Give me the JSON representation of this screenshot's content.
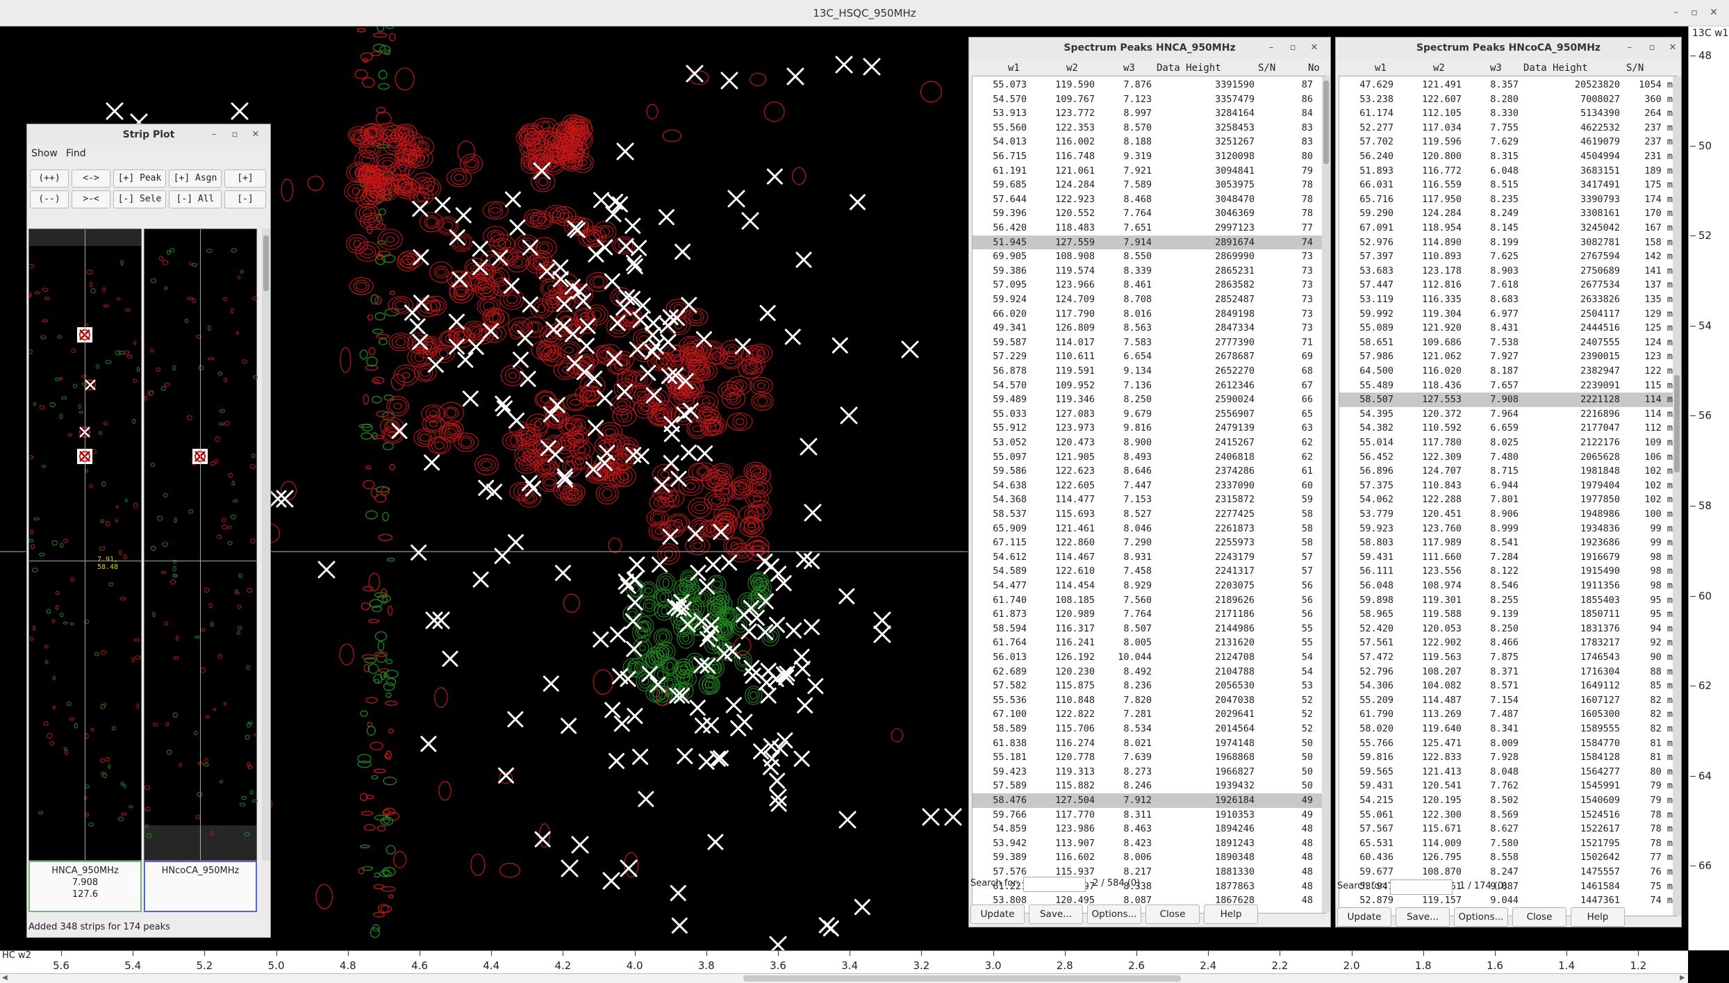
{
  "app": {
    "window_title": "13C_HSQC_950MHz",
    "controls": [
      "–",
      "▫",
      "✕"
    ]
  },
  "spectrum": {
    "xaxis_title": "HC w2",
    "yaxis_title": "13C w1",
    "xticks": [
      "5.6",
      "5.4",
      "5.2",
      "5.0",
      "4.8",
      "4.6",
      "4.4",
      "4.2",
      "4.0",
      "3.8",
      "3.6",
      "3.4",
      "3.2",
      "3.0",
      "2.8",
      "2.6",
      "2.4",
      "2.2",
      "2.0",
      "1.8",
      "1.6",
      "1.4",
      "1.2"
    ],
    "yticks": [
      "48",
      "50",
      "52",
      "54",
      "56",
      "58",
      "60",
      "62",
      "64",
      "66"
    ]
  },
  "strip_plot": {
    "title": "Strip Plot",
    "menus": [
      "Show",
      "Find"
    ],
    "row1": [
      "(++)",
      "<->",
      "[+] Peak",
      "[+] Asgn",
      "[+] Matc"
    ],
    "row2": [
      "(--)",
      ">-<",
      "[-] Sele",
      "[-] All",
      "[-] Matc"
    ],
    "cursor_label": "7.91, 58.48",
    "strips": [
      {
        "name": "HNCA_950MHz",
        "w3": "7.908",
        "w2": "127.6"
      },
      {
        "name": "HNcoCA_950MHz",
        "w3": "",
        "w2": ""
      }
    ],
    "status": "Added 348 strips for 174 peaks"
  },
  "peaks_hnca": {
    "title": "Spectrum Peaks HNCA_950MHz",
    "columns": [
      "w1",
      "w2",
      "w3",
      "Data Height",
      "S/N",
      "No"
    ],
    "rows": [
      [
        "55.073",
        "119.590",
        "7.876",
        "3391590",
        "87"
      ],
      [
        "54.570",
        "109.767",
        "7.123",
        "3357479",
        "86"
      ],
      [
        "53.913",
        "123.772",
        "8.997",
        "3284164",
        "84"
      ],
      [
        "55.560",
        "122.353",
        "8.570",
        "3258453",
        "83"
      ],
      [
        "54.013",
        "116.002",
        "8.188",
        "3251267",
        "83"
      ],
      [
        "56.715",
        "116.748",
        "9.319",
        "3120098",
        "80"
      ],
      [
        "61.191",
        "121.061",
        "7.921",
        "3094841",
        "79"
      ],
      [
        "59.685",
        "124.284",
        "7.589",
        "3053975",
        "78"
      ],
      [
        "57.644",
        "122.923",
        "8.468",
        "3048470",
        "78"
      ],
      [
        "59.396",
        "120.552",
        "7.764",
        "3046369",
        "78"
      ],
      [
        "56.420",
        "118.483",
        "7.651",
        "2997123",
        "77"
      ],
      [
        "51.945",
        "127.559",
        "7.914",
        "2891674",
        "74"
      ],
      [
        "69.905",
        "108.908",
        "8.550",
        "2869990",
        "73"
      ],
      [
        "59.386",
        "119.574",
        "8.339",
        "2865231",
        "73"
      ],
      [
        "57.095",
        "123.966",
        "8.461",
        "2863582",
        "73"
      ],
      [
        "59.924",
        "124.709",
        "8.708",
        "2852487",
        "73"
      ],
      [
        "66.020",
        "117.790",
        "8.016",
        "2849198",
        "73"
      ],
      [
        "49.341",
        "126.809",
        "8.563",
        "2847334",
        "73"
      ],
      [
        "59.587",
        "114.017",
        "7.583",
        "2777390",
        "71"
      ],
      [
        "57.229",
        "110.611",
        "6.654",
        "2678687",
        "69"
      ],
      [
        "56.878",
        "119.591",
        "9.134",
        "2652270",
        "68"
      ],
      [
        "54.570",
        "109.952",
        "7.136",
        "2612346",
        "67"
      ],
      [
        "59.489",
        "119.346",
        "8.250",
        "2590024",
        "66"
      ],
      [
        "55.033",
        "127.083",
        "9.679",
        "2556907",
        "65"
      ],
      [
        "55.912",
        "123.973",
        "9.816",
        "2479139",
        "63"
      ],
      [
        "53.052",
        "120.473",
        "8.900",
        "2415267",
        "62"
      ],
      [
        "55.097",
        "121.905",
        "8.493",
        "2406818",
        "62"
      ],
      [
        "59.586",
        "122.623",
        "8.646",
        "2374286",
        "61"
      ],
      [
        "54.638",
        "122.605",
        "7.447",
        "2337090",
        "60"
      ],
      [
        "54.368",
        "114.477",
        "7.153",
        "2315872",
        "59"
      ],
      [
        "58.537",
        "115.693",
        "8.527",
        "2277425",
        "58"
      ],
      [
        "65.909",
        "121.461",
        "8.046",
        "2261873",
        "58"
      ],
      [
        "67.115",
        "122.860",
        "7.290",
        "2255973",
        "58"
      ],
      [
        "54.612",
        "114.467",
        "8.931",
        "2243179",
        "57"
      ],
      [
        "54.589",
        "122.610",
        "7.458",
        "2241317",
        "57"
      ],
      [
        "54.477",
        "114.454",
        "8.929",
        "2203075",
        "56"
      ],
      [
        "61.740",
        "108.185",
        "7.560",
        "2189626",
        "56"
      ],
      [
        "61.873",
        "120.989",
        "7.764",
        "2171186",
        "56"
      ],
      [
        "58.594",
        "116.317",
        "8.507",
        "2144986",
        "55"
      ],
      [
        "61.764",
        "116.241",
        "8.005",
        "2131620",
        "55"
      ],
      [
        "56.013",
        "126.192",
        "10.044",
        "2124708",
        "54"
      ],
      [
        "62.689",
        "120.230",
        "8.492",
        "2104788",
        "54"
      ],
      [
        "57.582",
        "115.875",
        "8.236",
        "2056530",
        "53"
      ],
      [
        "55.536",
        "110.848",
        "7.820",
        "2047038",
        "52"
      ],
      [
        "67.100",
        "122.822",
        "7.281",
        "2029641",
        "52"
      ],
      [
        "58.589",
        "115.706",
        "8.534",
        "2014564",
        "52"
      ],
      [
        "61.838",
        "116.274",
        "8.021",
        "1974148",
        "50"
      ],
      [
        "55.181",
        "120.778",
        "7.639",
        "1968868",
        "50"
      ],
      [
        "59.423",
        "119.313",
        "8.273",
        "1966827",
        "50"
      ],
      [
        "57.589",
        "115.882",
        "8.246",
        "1939432",
        "50"
      ],
      [
        "58.476",
        "127.504",
        "7.912",
        "1926184",
        "49"
      ],
      [
        "59.766",
        "117.770",
        "8.311",
        "1910353",
        "49"
      ],
      [
        "54.859",
        "123.986",
        "8.463",
        "1894246",
        "48"
      ],
      [
        "53.942",
        "113.907",
        "8.423",
        "1891243",
        "48"
      ],
      [
        "59.389",
        "116.602",
        "8.006",
        "1890348",
        "48"
      ],
      [
        "57.576",
        "115.937",
        "8.217",
        "1881330",
        "48"
      ],
      [
        "61.221",
        "112.097",
        "8.338",
        "1877863",
        "48"
      ],
      [
        "53.808",
        "120.495",
        "8.087",
        "1867628",
        "48"
      ]
    ],
    "selected": [
      11,
      50
    ],
    "search_label": "Search for:",
    "count": "2 / 584 (0)",
    "buttons": [
      "Update",
      "Save...",
      "Options...",
      "Close",
      "Help"
    ]
  },
  "peaks_hncoca": {
    "title": "Spectrum Peaks HNcoCA_950MHz",
    "columns": [
      "w1",
      "w2",
      "w3",
      "Data Height",
      "S/N"
    ],
    "rows": [
      [
        "47.629",
        "121.491",
        "8.357",
        "20523820",
        "1054 m"
      ],
      [
        "53.238",
        "122.607",
        "8.280",
        "7008027",
        "360 m"
      ],
      [
        "61.174",
        "112.105",
        "8.330",
        "5134390",
        "264 m"
      ],
      [
        "52.277",
        "117.034",
        "7.755",
        "4622532",
        "237 m"
      ],
      [
        "57.702",
        "119.596",
        "7.629",
        "4619079",
        "237 m"
      ],
      [
        "56.240",
        "120.800",
        "8.315",
        "4504994",
        "231 m"
      ],
      [
        "51.893",
        "116.772",
        "6.048",
        "3683151",
        "189 m"
      ],
      [
        "66.031",
        "116.559",
        "8.515",
        "3417491",
        "175 m"
      ],
      [
        "65.716",
        "117.950",
        "8.235",
        "3390793",
        "174 m"
      ],
      [
        "59.290",
        "124.284",
        "8.249",
        "3308161",
        "170 m"
      ],
      [
        "67.091",
        "118.954",
        "8.145",
        "3245042",
        "167 m"
      ],
      [
        "52.976",
        "114.890",
        "8.199",
        "3082781",
        "158 m"
      ],
      [
        "57.397",
        "110.893",
        "7.625",
        "2767594",
        "142 m"
      ],
      [
        "53.683",
        "123.178",
        "8.903",
        "2750689",
        "141 m"
      ],
      [
        "57.447",
        "112.816",
        "7.618",
        "2677534",
        "137 m"
      ],
      [
        "53.119",
        "116.335",
        "8.683",
        "2633826",
        "135 m"
      ],
      [
        "59.992",
        "119.304",
        "6.977",
        "2504117",
        "129 m"
      ],
      [
        "55.089",
        "121.920",
        "8.431",
        "2444516",
        "125 m"
      ],
      [
        "58.651",
        "109.686",
        "7.538",
        "2407555",
        "124 m"
      ],
      [
        "57.986",
        "121.062",
        "7.927",
        "2390015",
        "123 m"
      ],
      [
        "64.500",
        "116.020",
        "8.187",
        "2382947",
        "122 m"
      ],
      [
        "55.489",
        "118.436",
        "7.657",
        "2239091",
        "115 m"
      ],
      [
        "58.507",
        "127.553",
        "7.908",
        "2221128",
        "114 m"
      ],
      [
        "54.395",
        "120.372",
        "7.964",
        "2216896",
        "114 m"
      ],
      [
        "54.382",
        "110.592",
        "6.659",
        "2177047",
        "112 m"
      ],
      [
        "55.014",
        "117.780",
        "8.025",
        "2122176",
        "109 m"
      ],
      [
        "56.452",
        "122.309",
        "7.480",
        "2065628",
        "106 m"
      ],
      [
        "56.896",
        "124.707",
        "8.715",
        "1981848",
        "102 m"
      ],
      [
        "57.375",
        "110.843",
        "6.944",
        "1979404",
        "102 m"
      ],
      [
        "54.062",
        "122.288",
        "7.801",
        "1977850",
        "102 m"
      ],
      [
        "53.779",
        "120.451",
        "8.906",
        "1948986",
        "100 m"
      ],
      [
        "59.923",
        "123.760",
        "8.999",
        "1934836",
        "99 m"
      ],
      [
        "58.803",
        "117.989",
        "8.541",
        "1923686",
        "99 m"
      ],
      [
        "59.431",
        "111.660",
        "7.284",
        "1916679",
        "98 m"
      ],
      [
        "56.111",
        "123.556",
        "8.122",
        "1915490",
        "98 m"
      ],
      [
        "56.048",
        "108.974",
        "8.546",
        "1911356",
        "98 m"
      ],
      [
        "59.898",
        "119.301",
        "8.255",
        "1855403",
        "95 m"
      ],
      [
        "58.965",
        "119.588",
        "9.139",
        "1850711",
        "95 m"
      ],
      [
        "52.420",
        "120.053",
        "8.250",
        "1831376",
        "94 m"
      ],
      [
        "57.561",
        "122.902",
        "8.466",
        "1783217",
        "92 m"
      ],
      [
        "57.472",
        "119.563",
        "7.875",
        "1746543",
        "90 m"
      ],
      [
        "52.796",
        "108.207",
        "8.371",
        "1716304",
        "88 m"
      ],
      [
        "54.306",
        "104.082",
        "8.571",
        "1649112",
        "85 m"
      ],
      [
        "55.209",
        "114.487",
        "7.154",
        "1607127",
        "82 m"
      ],
      [
        "61.790",
        "113.269",
        "7.487",
        "1605300",
        "82 m"
      ],
      [
        "58.020",
        "119.640",
        "8.341",
        "1589555",
        "82 m"
      ],
      [
        "55.766",
        "125.471",
        "8.009",
        "1584770",
        "81 m"
      ],
      [
        "59.816",
        "122.833",
        "7.928",
        "1584128",
        "81 m"
      ],
      [
        "59.565",
        "121.413",
        "8.048",
        "1564277",
        "80 m"
      ],
      [
        "59.431",
        "120.541",
        "7.762",
        "1545991",
        "79 m"
      ],
      [
        "54.215",
        "120.195",
        "8.502",
        "1540609",
        "79 m"
      ],
      [
        "55.061",
        "122.300",
        "8.569",
        "1524516",
        "78 m"
      ],
      [
        "57.567",
        "115.671",
        "8.627",
        "1522617",
        "78 m"
      ],
      [
        "65.531",
        "114.009",
        "7.580",
        "1521795",
        "78 m"
      ],
      [
        "60.436",
        "126.795",
        "8.558",
        "1502642",
        "77 m"
      ],
      [
        "59.677",
        "108.870",
        "8.247",
        "1475557",
        "76 m"
      ],
      [
        "53.947",
        "125.361",
        "9.887",
        "1461584",
        "75 m"
      ],
      [
        "52.879",
        "119.157",
        "9.044",
        "1447361",
        "74 m"
      ]
    ],
    "selected": [
      22
    ],
    "search_label": "Search for:",
    "count": "1 / 174 (0)",
    "buttons": [
      "Update",
      "Save...",
      "Options...",
      "Close",
      "Help"
    ]
  }
}
